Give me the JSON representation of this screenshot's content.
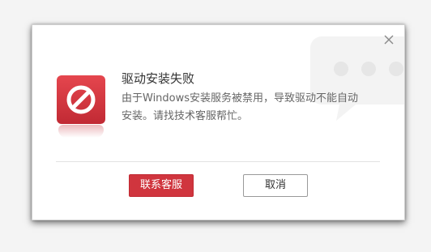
{
  "dialog": {
    "title": "驱动安装失败",
    "message": "由于Windows安装服务被禁用，导致驱动不能自动安装。请找技术客服帮忙。",
    "close_icon": "close-icon",
    "status_icon": "prohibited-icon",
    "watermark_icon": "chat-bubble-icon"
  },
  "buttons": {
    "contact_label": "联系客服",
    "cancel_label": "取消"
  },
  "colors": {
    "accent": "#d0353e",
    "icon_bg": "#d63a43",
    "title_text": "#333333",
    "message_text": "#666666",
    "divider": "#e2e2e2"
  }
}
